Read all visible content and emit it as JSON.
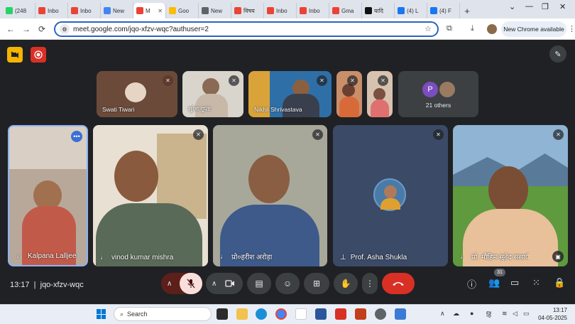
{
  "browser": {
    "tabs": [
      {
        "label": "(248",
        "color": "#25d366",
        "active": false
      },
      {
        "label": "Inbo",
        "color": "#ea4335",
        "active": false
      },
      {
        "label": "Inbo",
        "color": "#ea4335",
        "active": false
      },
      {
        "label": "New",
        "color": "#4285f4",
        "active": false
      },
      {
        "label": "M",
        "color": "#ea4335",
        "active": true
      },
      {
        "label": "Goo",
        "color": "#fbbc05",
        "active": false
      },
      {
        "label": "New",
        "color": "#5f6368",
        "active": false
      },
      {
        "label": "विषय",
        "color": "#ea4335",
        "active": false
      },
      {
        "label": "Inbo",
        "color": "#ea4335",
        "active": false
      },
      {
        "label": "Inbo",
        "color": "#ea4335",
        "active": false
      },
      {
        "label": "Gma",
        "color": "#ea4335",
        "active": false
      },
      {
        "label": "यादि",
        "color": "#111111",
        "active": false
      },
      {
        "label": "(4) L",
        "color": "#1877f2",
        "active": false
      },
      {
        "label": "(4) F",
        "color": "#1877f2",
        "active": false
      }
    ],
    "new_tab_label": "+",
    "url": "meet.google.com/jqo-xfzv-wqc?authuser=2",
    "new_chrome_label": "New Chrome available",
    "window_controls": [
      "⌄",
      "—",
      "❐",
      "✕"
    ]
  },
  "meeting": {
    "code": "jqo-xfzv-wqc",
    "time": "13:17",
    "participant_count_badge": "31",
    "top_strip": [
      {
        "name": "Swati Tiwari",
        "bg": "#6b4a3a"
      },
      {
        "name": "सुरेश गुप्ता",
        "bg": "#d9d4cc"
      },
      {
        "name": "Nikhil Shrivastava",
        "bg": "#2f6fa8"
      },
      {
        "name": "",
        "bg": "#c98f6a"
      },
      {
        "name": "",
        "bg": "#d7c2b0"
      }
    ],
    "others": {
      "label": "21 others",
      "avatar_letter": "P",
      "avatar_color": "#7c4dbe"
    },
    "main_tiles": [
      {
        "name": "Kalpana Lalljee",
        "bg": "#b8a89a",
        "highlight": true
      },
      {
        "name": "vinod kumar mishra",
        "bg": "#8a7a62",
        "highlight": false
      },
      {
        "name": "प्रो०हरीश अरोड़ा",
        "bg": "#6f6b5c",
        "highlight": false
      },
      {
        "name": "Prof. Asha Shukla",
        "bg": "#3b4a66",
        "highlight": false
      },
      {
        "name": "प्रो. मौहिम सुनेद ससार्य",
        "bg": "#4d7a3a",
        "highlight": false
      }
    ]
  },
  "taskbar": {
    "search_placeholder": "Search",
    "time": "13:17",
    "date": "04-05-2025",
    "lang": "हिं"
  }
}
